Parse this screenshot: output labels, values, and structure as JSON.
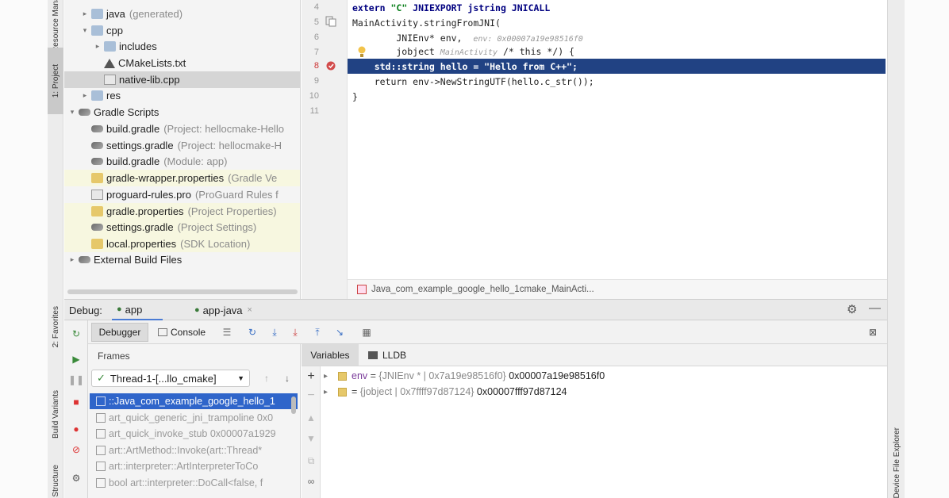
{
  "left_strip": {
    "tabs": [
      "Resource Manager",
      "1: Project",
      "2: Favorites",
      "Build Variants",
      "Structure"
    ]
  },
  "right_strip": {
    "tabs": [
      "Device File Explorer"
    ]
  },
  "project_tree": [
    {
      "label": "java",
      "muted": "(generated)",
      "icon": "folder-icon",
      "arrow": "▸"
    },
    {
      "label": "cpp",
      "muted": "",
      "icon": "folder-icon",
      "arrow": "▾"
    },
    {
      "label": "includes",
      "muted": "",
      "icon": "folder-icon",
      "arrow": "▸"
    },
    {
      "label": "CMakeLists.txt",
      "muted": "",
      "icon": "cmake-icon",
      "arrow": ""
    },
    {
      "label": "native-lib.cpp",
      "muted": "",
      "icon": "cpp-file-icon",
      "arrow": ""
    },
    {
      "label": "res",
      "muted": "",
      "icon": "folder-icon",
      "arrow": "▸"
    },
    {
      "label": "Gradle Scripts",
      "muted": "",
      "icon": "gradle-icon",
      "arrow": "▾"
    },
    {
      "label": "build.gradle",
      "muted": "(Project: hellocmake-Hello",
      "icon": "gradle-icon",
      "arrow": ""
    },
    {
      "label": "settings.gradle",
      "muted": "(Project: hellocmake-H",
      "icon": "gradle-icon",
      "arrow": ""
    },
    {
      "label": "build.gradle",
      "muted": "(Module: app)",
      "icon": "gradle-icon",
      "arrow": ""
    },
    {
      "label": "gradle-wrapper.properties",
      "muted": "(Gradle Ve",
      "icon": "properties-icon",
      "arrow": ""
    },
    {
      "label": "proguard-rules.pro",
      "muted": "(ProGuard Rules f",
      "icon": "file-icon",
      "arrow": ""
    },
    {
      "label": "gradle.properties",
      "muted": "(Project Properties)",
      "icon": "properties-icon",
      "arrow": ""
    },
    {
      "label": "settings.gradle",
      "muted": "(Project Settings)",
      "icon": "gradle-icon",
      "arrow": ""
    },
    {
      "label": "local.properties",
      "muted": "(SDK Location)",
      "icon": "properties-icon",
      "arrow": ""
    },
    {
      "label": "External Build Files",
      "muted": "",
      "icon": "gradle-icon",
      "arrow": "▸"
    }
  ],
  "editor": {
    "line_numbers": [
      "4",
      "5",
      "6",
      "7",
      "8",
      "9",
      "10",
      "11"
    ],
    "line1_a": "extern ",
    "line1_b": "\"C\"",
    "line1_c": " JNIEXPORT jstring JNICALL",
    "line2": "MainActivity.stringFromJNI(",
    "line3_code": "        JNIEnv* env,",
    "line3_hint": "env: 0x00007a19e98516f0",
    "line4_a": "        jobject",
    "line4_hint": "MainActivity",
    "line4_b": " /* this */) {",
    "line5": "    std::string hello = \"Hello from C++\";",
    "line6": "    return env->NewStringUTF(hello.c_str());",
    "line7": "}",
    "breadcrumb": "Java_com_example_google_hello_1cmake_MainActi..."
  },
  "debug": {
    "label": "Debug:",
    "session_tabs": [
      "app",
      "app-java"
    ],
    "tabs": [
      "Debugger",
      "Console"
    ],
    "frames_label": "Frames",
    "thread": "Thread-1-[...llo_cmake]",
    "variables_tab": "Variables",
    "lldb_tab": "LLDB"
  },
  "frames": [
    {
      "label": "::Java_com_example_google_hello_1",
      "selected": true
    },
    {
      "label": "art_quick_generic_jni_trampoline 0x0",
      "selected": false
    },
    {
      "label": "art_quick_invoke_stub 0x00007a1929",
      "selected": false
    },
    {
      "label": "art::ArtMethod::Invoke(art::Thread*",
      "selected": false
    },
    {
      "label": "art::interpreter::ArtInterpreterToCo",
      "selected": false
    },
    {
      "label": "bool art::interpreter::DoCall<false, f",
      "selected": false
    }
  ],
  "variables": [
    {
      "name": "env",
      "eq": " = ",
      "type": "{JNIEnv * | 0x7a19e98516f0}",
      "value": " 0x00007a19e98516f0"
    },
    {
      "name": "",
      "eq": "= ",
      "type": "{jobject | 0x7ffff97d87124}",
      "value": " 0x00007fff97d87124"
    }
  ]
}
